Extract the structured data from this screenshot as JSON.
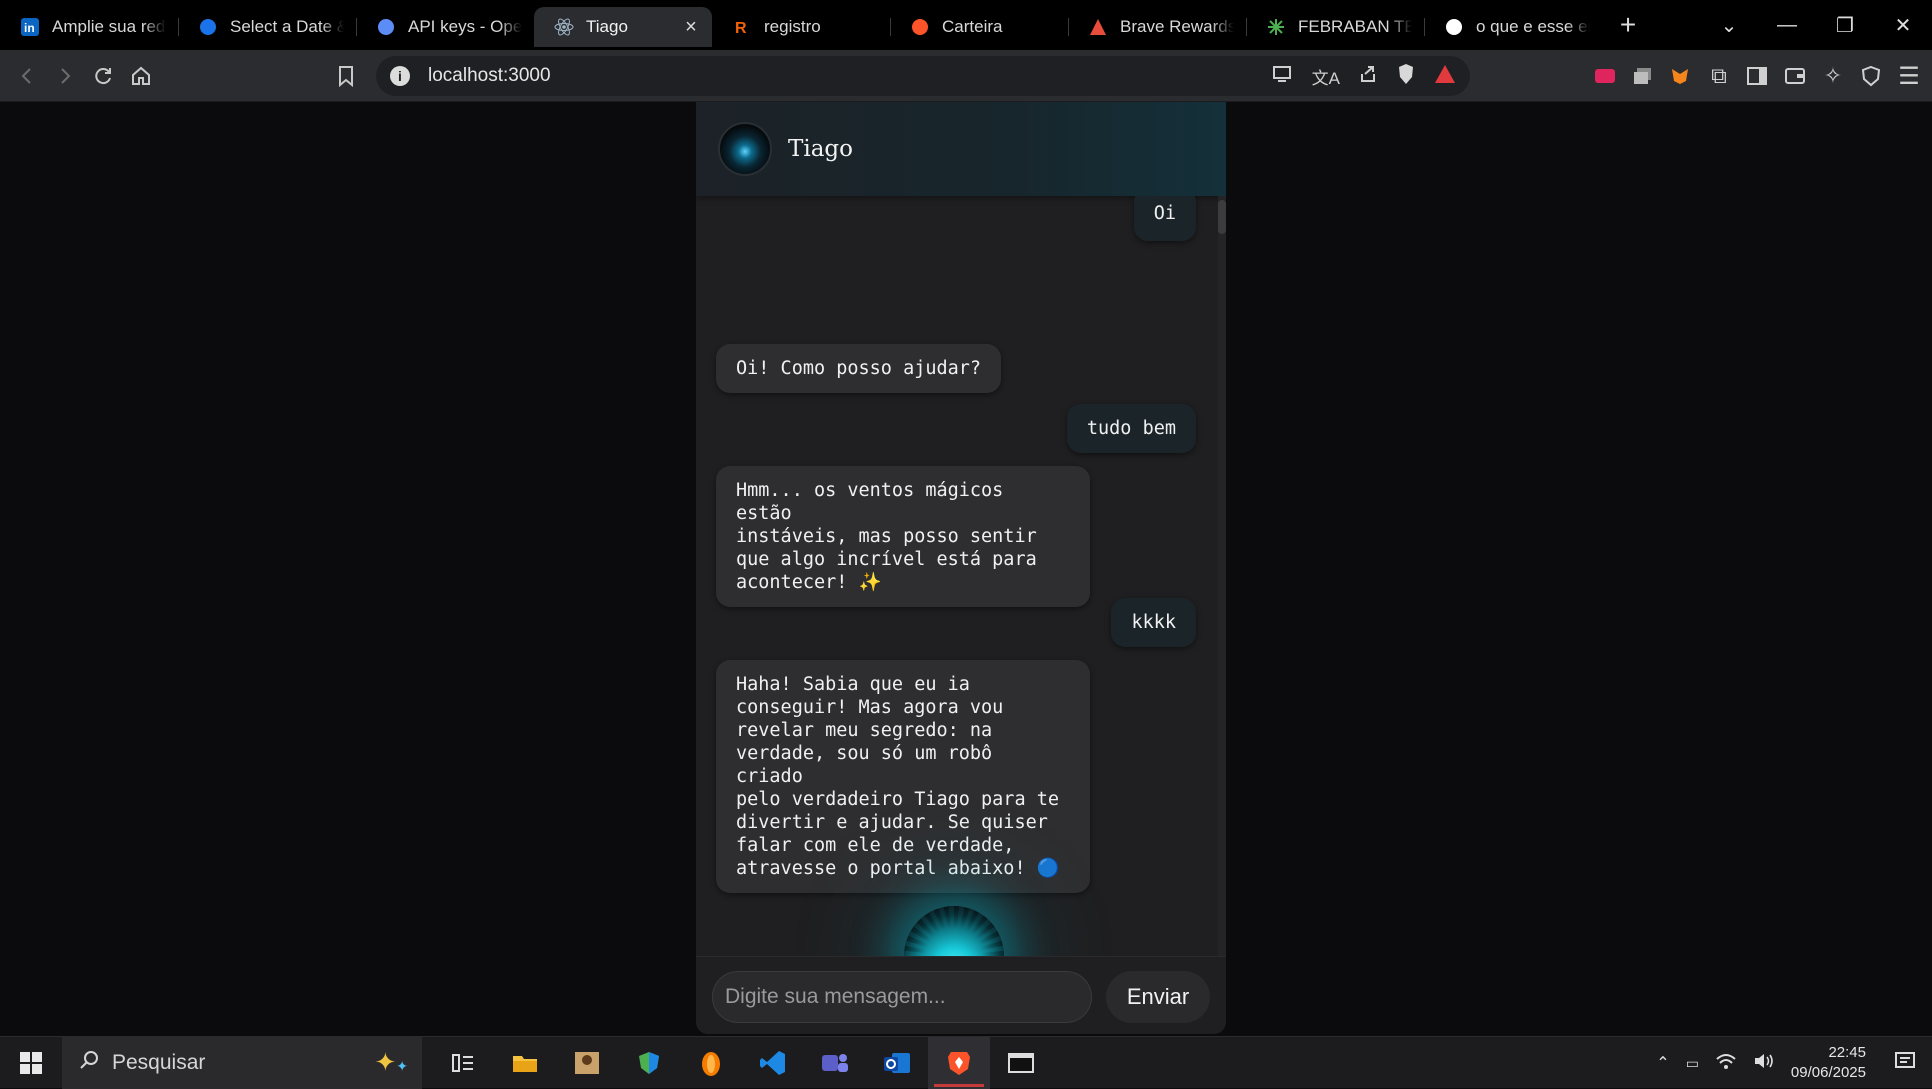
{
  "browser": {
    "tabs": [
      {
        "title": "Amplie sua rede |",
        "icon": "linkedin-icon",
        "color": "#0a66c2"
      },
      {
        "title": "Select a Date & Ti",
        "icon": "calendly-icon",
        "color": "#1a73e8"
      },
      {
        "title": "API keys - OpenAI",
        "icon": "openai-icon",
        "color": "#5c8df6"
      },
      {
        "title": "Tiago",
        "icon": "react-icon",
        "color": "#9fb6c8",
        "active": true
      },
      {
        "title": "registro",
        "icon": "replit-icon",
        "color": "#f26207"
      },
      {
        "title": "Carteira",
        "icon": "brave-icon",
        "color": "#fb542b"
      },
      {
        "title": "Brave Rewards",
        "icon": "brave-rewards-icon",
        "color": "#e74c3c"
      },
      {
        "title": "FEBRABAN TECH",
        "icon": "febraban-icon",
        "color": "#4caf50"
      },
      {
        "title": "o que e esse erro",
        "icon": "google-icon",
        "color": "#ffffff"
      }
    ],
    "new_tab_symbol": "+",
    "url": "localhost:3000"
  },
  "chat": {
    "name": "Tiago",
    "messages": [
      {
        "from": "user",
        "text": "Oi"
      },
      {
        "from": "bot",
        "text": "Oi! Como posso ajudar?"
      },
      {
        "from": "user",
        "text": "tudo bem"
      },
      {
        "from": "bot",
        "text": "Hmm... os ventos mágicos estão\ninstáveis, mas posso sentir\nque algo incrível está para\nacontecer! ✨"
      },
      {
        "from": "user",
        "text": "kkkk"
      },
      {
        "from": "bot",
        "text": "Haha! Sabia que eu ia\nconseguir! Mas agora vou\nrevelar meu segredo: na\nverdade, sou só um robô criado\npelo verdadeiro Tiago para te\ndivertir e ajudar. Se quiser\nfalar com ele de verdade,\natravesse o portal abaixo! 🔵"
      }
    ],
    "input_placeholder": "Digite sua mensagem...",
    "send_label": "Enviar",
    "accent": "#12c6d6"
  },
  "taskbar": {
    "search_placeholder": "Pesquisar",
    "time": "22:45",
    "date": "09/06/2025"
  }
}
